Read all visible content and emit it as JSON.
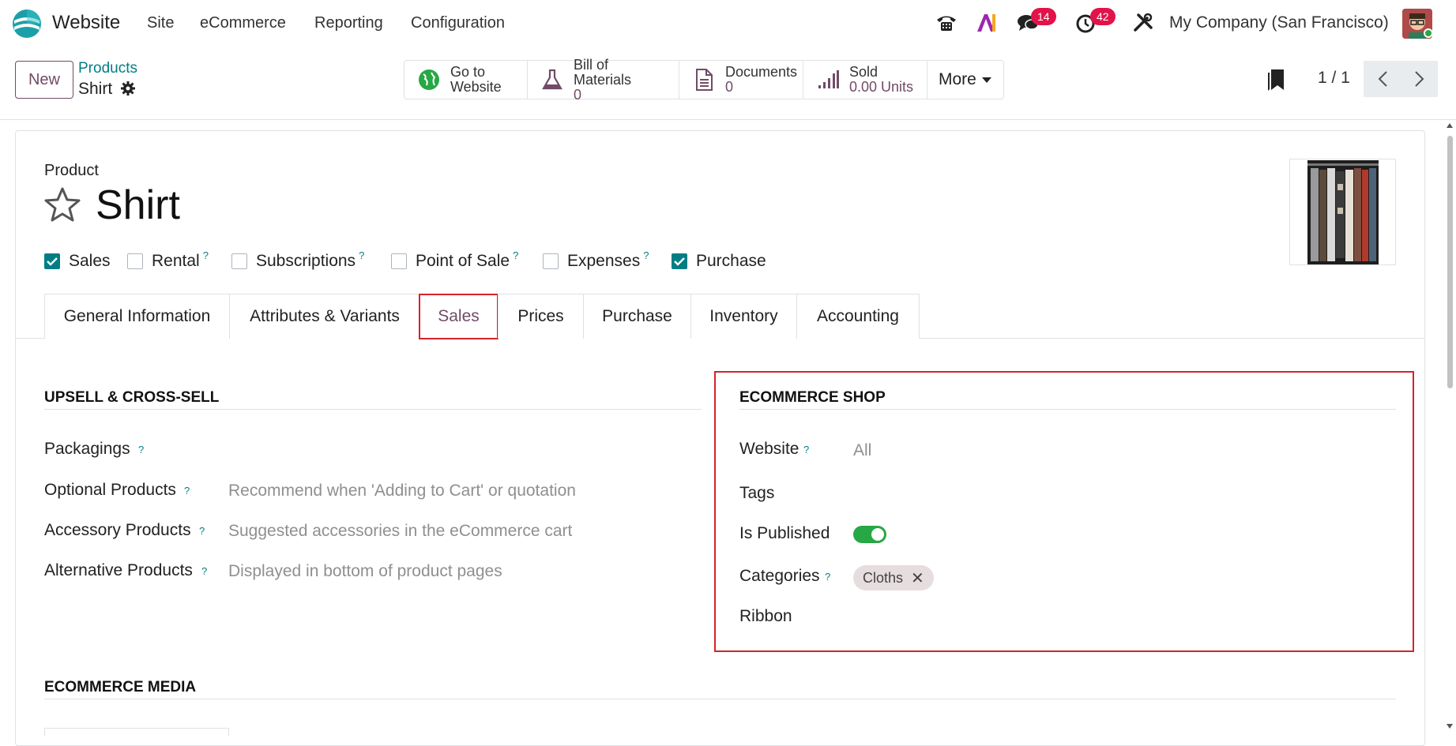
{
  "navbar": {
    "app_name": "Website",
    "menu": [
      "Site",
      "eCommerce",
      "Reporting",
      "Configuration"
    ],
    "messages_count": "14",
    "activities_count": "42",
    "company": "My Company (San Francisco)",
    "icons": [
      "phone-icon",
      "ai-icon",
      "chat-icon",
      "clock-icon",
      "tools-icon"
    ]
  },
  "control": {
    "new_label": "New",
    "breadcrumb_parent": "Products",
    "breadcrumb_current": "Shirt",
    "stats": {
      "website": {
        "line1": "Go to",
        "line2": "Website"
      },
      "bom": {
        "label": "Bill of Materials",
        "value": "0"
      },
      "documents": {
        "label": "Documents",
        "value": "0"
      },
      "sold": {
        "label": "Sold",
        "value": "0.00 Units"
      },
      "more": "More"
    },
    "pager": "1 / 1"
  },
  "form": {
    "product_label": "Product",
    "title": "Shirt",
    "checkboxes": [
      {
        "label": "Sales",
        "checked": true,
        "help": ""
      },
      {
        "label": "Rental",
        "checked": false,
        "help": "?"
      },
      {
        "label": "Subscriptions",
        "checked": false,
        "help": "?"
      },
      {
        "label": "Point of Sale",
        "checked": false,
        "help": "?"
      },
      {
        "label": "Expenses",
        "checked": false,
        "help": "?"
      },
      {
        "label": "Purchase",
        "checked": true,
        "help": ""
      }
    ],
    "tabs": [
      "General Information",
      "Attributes & Variants",
      "Sales",
      "Prices",
      "Purchase",
      "Inventory",
      "Accounting"
    ],
    "active_tab": "Sales",
    "upsell": {
      "title": "UPSELL & CROSS-SELL",
      "packagings": "Packagings",
      "optional": "Optional Products",
      "optional_ph": "Recommend when 'Adding to Cart' or quotation",
      "accessory": "Accessory Products",
      "accessory_ph": "Suggested accessories in the eCommerce cart",
      "alternative": "Alternative Products",
      "alternative_ph": "Displayed in bottom of product pages",
      "help": "?"
    },
    "shop": {
      "title": "ECOMMERCE SHOP",
      "website": "Website",
      "website_ph": "All",
      "tags": "Tags",
      "published": "Is Published",
      "published_on": true,
      "categories": "Categories",
      "category_tag": "Cloths",
      "ribbon": "Ribbon",
      "help": "?"
    },
    "media": {
      "title": "ECOMMERCE MEDIA"
    }
  },
  "colors": {
    "accent": "#714b67",
    "teal": "#017e84",
    "highlight": "#d3232b",
    "badge": "#e2134a",
    "toggle": "#28a745"
  }
}
